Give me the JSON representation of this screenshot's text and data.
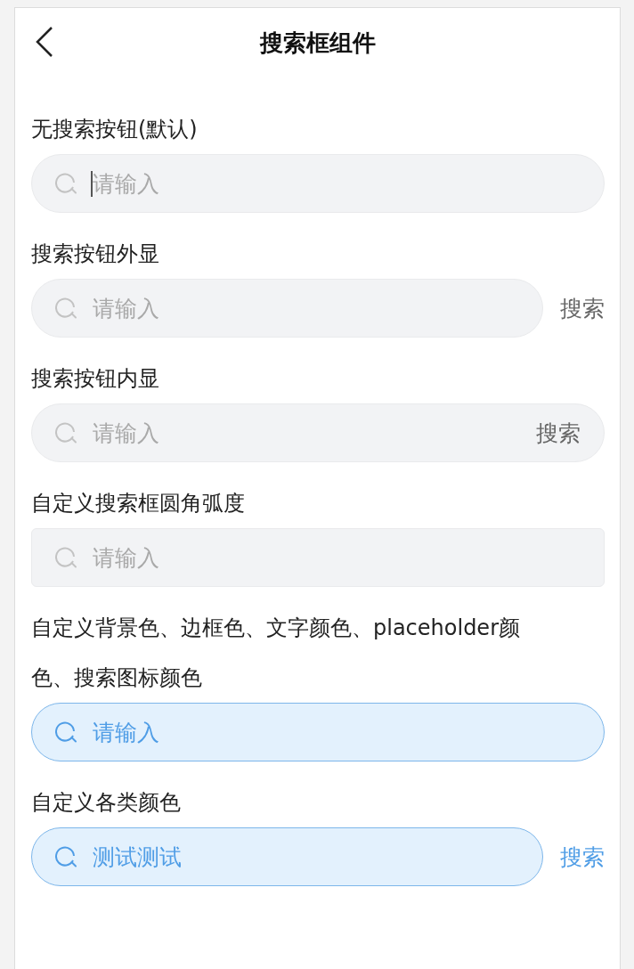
{
  "header": {
    "title": "搜索框组件"
  },
  "sections": [
    {
      "label": "无搜索按钮(默认)",
      "kind": "default",
      "field": {
        "placeholder": "请输入",
        "focused": true
      }
    },
    {
      "label": "搜索按钮外显",
      "kind": "default",
      "field": {
        "placeholder": "请输入",
        "focused": false
      },
      "button": {
        "label": "搜索",
        "kind": "outside"
      }
    },
    {
      "label": "搜索按钮内显",
      "kind": "default",
      "field": {
        "placeholder": "请输入",
        "focused": false
      },
      "button": {
        "label": "搜索",
        "kind": "inside"
      }
    },
    {
      "label": "自定义搜索框圆角弧度",
      "kind": "square",
      "field": {
        "placeholder": "请输入",
        "focused": false
      }
    },
    {
      "label": "自定义背景色、边框色、文字颜色、placeholder颜色、搜索图标颜色",
      "kind": "blue",
      "field": {
        "placeholder": "请输入",
        "focused": false
      }
    },
    {
      "label": "自定义各类颜色",
      "kind": "blue",
      "field": {
        "value": "测试测试",
        "focused": false
      },
      "button": {
        "label": "搜索",
        "kind": "outside"
      }
    }
  ]
}
